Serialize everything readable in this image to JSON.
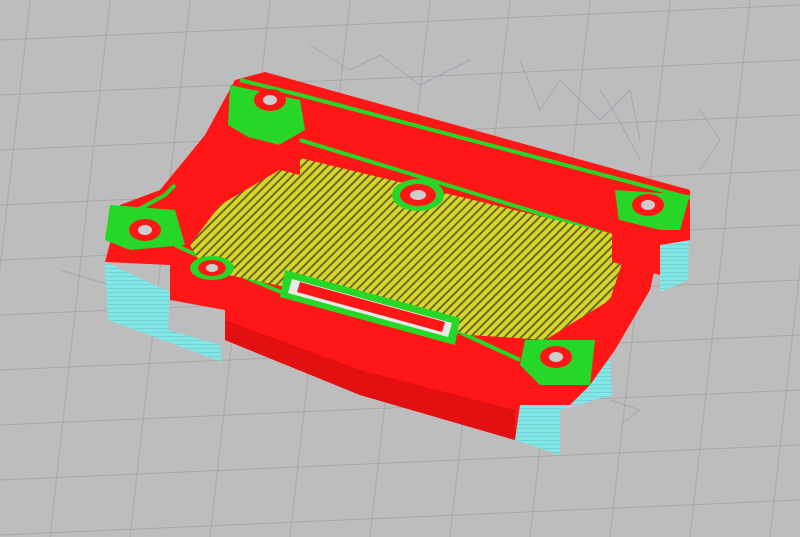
{
  "scene": {
    "description_visible_text": [],
    "colors": {
      "background": "#bdbdbd",
      "grid": "#a9a9a9",
      "outer_wall": "#ff1a1a",
      "inner_wall": "#22d622",
      "infill": "#d9d62a",
      "support": "#7fe3e3",
      "support_dark": "#5fc9cf",
      "travel_moves": "#9aa3b5"
    }
  }
}
